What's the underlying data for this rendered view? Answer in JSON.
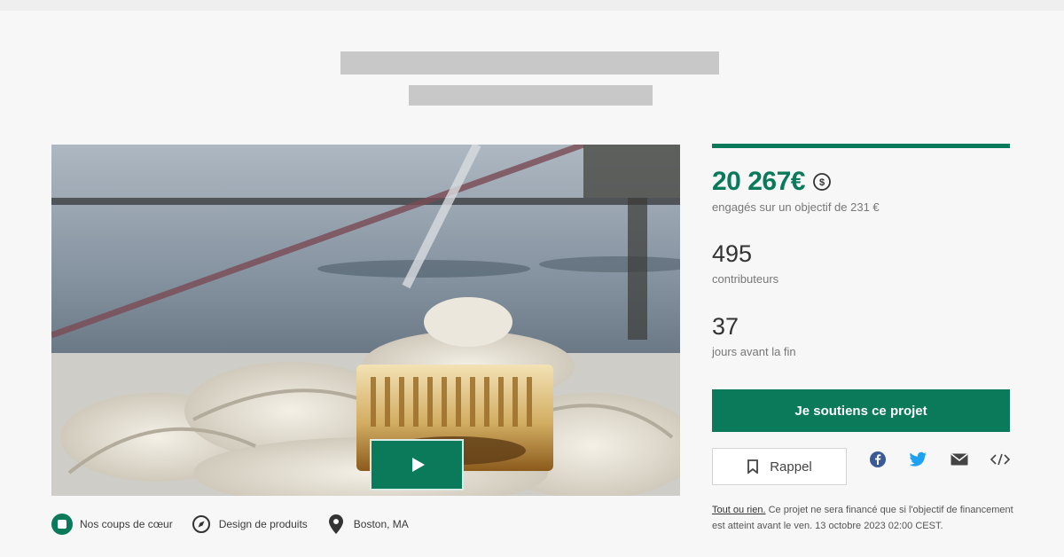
{
  "campaign": {
    "amount": "20 267€",
    "goal_text": "engagés sur un objectif de 231 €",
    "funded_ratio": 1.0,
    "contributors_value": "495",
    "contributors_label": "contributeurs",
    "days_value": "37",
    "days_label": "jours avant la fin"
  },
  "actions": {
    "support_label": "Je soutiens ce projet",
    "reminder_label": "Rappel"
  },
  "tags": [
    {
      "label": "Nos coups de cœur",
      "icon": "heart-badge-icon"
    },
    {
      "label": "Design de produits",
      "icon": "compass-icon"
    },
    {
      "label": "Boston, MA",
      "icon": "location-pin-icon"
    }
  ],
  "share_icons": [
    "facebook-icon",
    "twitter-icon",
    "email-icon",
    "embed-icon"
  ],
  "fineprint": {
    "link": "Tout ou rien.",
    "text": " Ce projet ne sera financé que si l'objectif de financement est atteint avant le ven. 13 octobre 2023 02:00 CEST."
  },
  "colors": {
    "accent": "#0a7a5b",
    "background": "#f7f7f7"
  }
}
